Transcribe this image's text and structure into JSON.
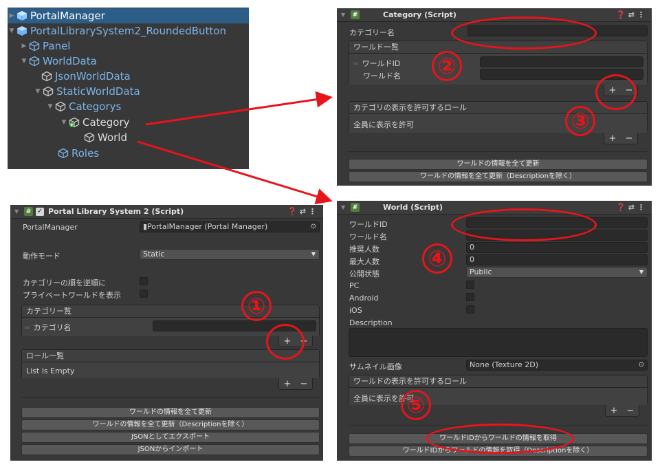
{
  "hierarchy": {
    "items": [
      {
        "label": "PortalManager",
        "selected": true
      },
      {
        "label": "PortalLibrarySystem2_RoundedButton"
      },
      {
        "label": "Panel"
      },
      {
        "label": "WorldData"
      },
      {
        "label": "JsonWorldData"
      },
      {
        "label": "StaticWorldData"
      },
      {
        "label": "Categorys"
      },
      {
        "label": "Category"
      },
      {
        "label": "World"
      },
      {
        "label": "Roles"
      }
    ]
  },
  "category_inspector": {
    "title": "Category (Script)",
    "category_name_label": "カテゴリー名",
    "world_list_header": "ワールド一覧",
    "world_id_label": "ワールドID",
    "world_name_label": "ワールド名",
    "roles_header": "カテゴリの表示を許可するロール",
    "roles_body": "全員に表示を許可",
    "plus": "+",
    "minus": "−",
    "btn_update_all": "ワールドの情報を全て更新",
    "btn_update_all_no_desc": "ワールドの情報を全て更新（Descriptionを除く）"
  },
  "portal_inspector": {
    "title": "Portal Library System 2 (Script)",
    "portal_manager_label": "PortalManager",
    "portal_manager_value": "PortalManager (Portal Manager)",
    "mode_label": "動作モード",
    "mode_value": "Static",
    "reverse_order_label": "カテゴリーの順を逆順に",
    "show_private_label": "プライベートワールドを表示",
    "category_list_header": "カテゴリー覧",
    "category_name_label": "カテゴリ名",
    "role_list_header": "ロール一覧",
    "role_list_body": "List is Empty",
    "plus": "+",
    "minus": "−",
    "btn_update_all": "ワールドの情報を全て更新",
    "btn_update_all_no_desc": "ワールドの情報を全て更新（Descriptionを除く）",
    "btn_export_json": "JSONとしてエクスポート",
    "btn_import_json": "JSONからインポート"
  },
  "world_inspector": {
    "title": "World (Script)",
    "world_id_label": "ワールドID",
    "world_name_label": "ワールド名",
    "recommended_label": "推奨人数",
    "recommended_value": "0",
    "max_label": "最大人数",
    "max_value": "0",
    "visibility_label": "公開状態",
    "visibility_value": "Public",
    "pc_label": "PC",
    "android_label": "Android",
    "ios_label": "iOS",
    "description_label": "Description",
    "thumbnail_label": "サムネイル画像",
    "thumbnail_value": "None (Texture 2D)",
    "roles_header": "ワールドの表示を許可するロール",
    "roles_body": "全員に表示を許可",
    "plus": "+",
    "minus": "−",
    "btn_fetch": "ワールドIDからワールドの情報を取得",
    "btn_fetch_no_desc": "ワールドIDからワールドの情報を取得（Descriptionを除く）"
  },
  "annotations": {
    "n1": "①",
    "n2": "②",
    "n3": "③",
    "n4": "④",
    "n5": "⑤",
    "color": "#e8141b"
  },
  "colors": {
    "panel_bg": "#383838",
    "selection": "#2c5d87",
    "prefab_blue": "#7cb4ea"
  }
}
